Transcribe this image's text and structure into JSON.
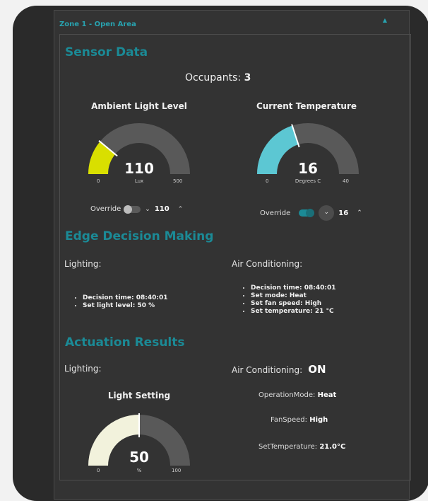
{
  "zone": {
    "title": "Zone 1 - Open Area",
    "collapse_icon": "caret-up-icon"
  },
  "sensor": {
    "heading": "Sensor Data",
    "occupants_label": "Occupants:",
    "occupants_value": "3",
    "light_gauge": {
      "title": "Ambient Light Level",
      "value": "110",
      "unit": "Lux",
      "min": "0",
      "max": "500",
      "fill_fraction": 0.22,
      "color": "#d9df00"
    },
    "temp_gauge": {
      "title": "Current Temperature",
      "value": "16",
      "unit": "Degrees C",
      "min": "0",
      "max": "40",
      "fill_fraction": 0.4,
      "color": "#5cc7d3"
    },
    "light_override": {
      "label": "Override",
      "enabled": false,
      "value": "110"
    },
    "temp_override": {
      "label": "Override",
      "enabled": true,
      "value": "16"
    }
  },
  "edge": {
    "heading": "Edge Decision Making",
    "lighting_label": "Lighting:",
    "lighting_items": [
      "Decision time: 08:40:01",
      "Set light level: 50 %"
    ],
    "ac_label": "Air Conditioning:",
    "ac_items": [
      "Decision time: 08:40:01",
      "Set mode: Heat",
      "Set fan speed: High",
      "Set temperature: 21 °C"
    ]
  },
  "actuation": {
    "heading": "Actuation Results",
    "lighting_label": "Lighting:",
    "ac_label": "Air Conditioning:",
    "ac_state": "ON",
    "light_gauge": {
      "title": "Light Setting",
      "value": "50",
      "unit": "%",
      "min": "0",
      "max": "100",
      "fill_fraction": 0.5,
      "color": "#f2f2dc"
    },
    "operation_mode_label": "OperationMode:",
    "operation_mode_value": "Heat",
    "fan_speed_label": "FanSpeed:",
    "fan_speed_value": "High",
    "set_temp_label": "SetTemperature:",
    "set_temp_value": "21.0°C"
  },
  "colors": {
    "accent": "#1b8a96",
    "track": "#595959",
    "toggle_on": "#1b8a96"
  }
}
